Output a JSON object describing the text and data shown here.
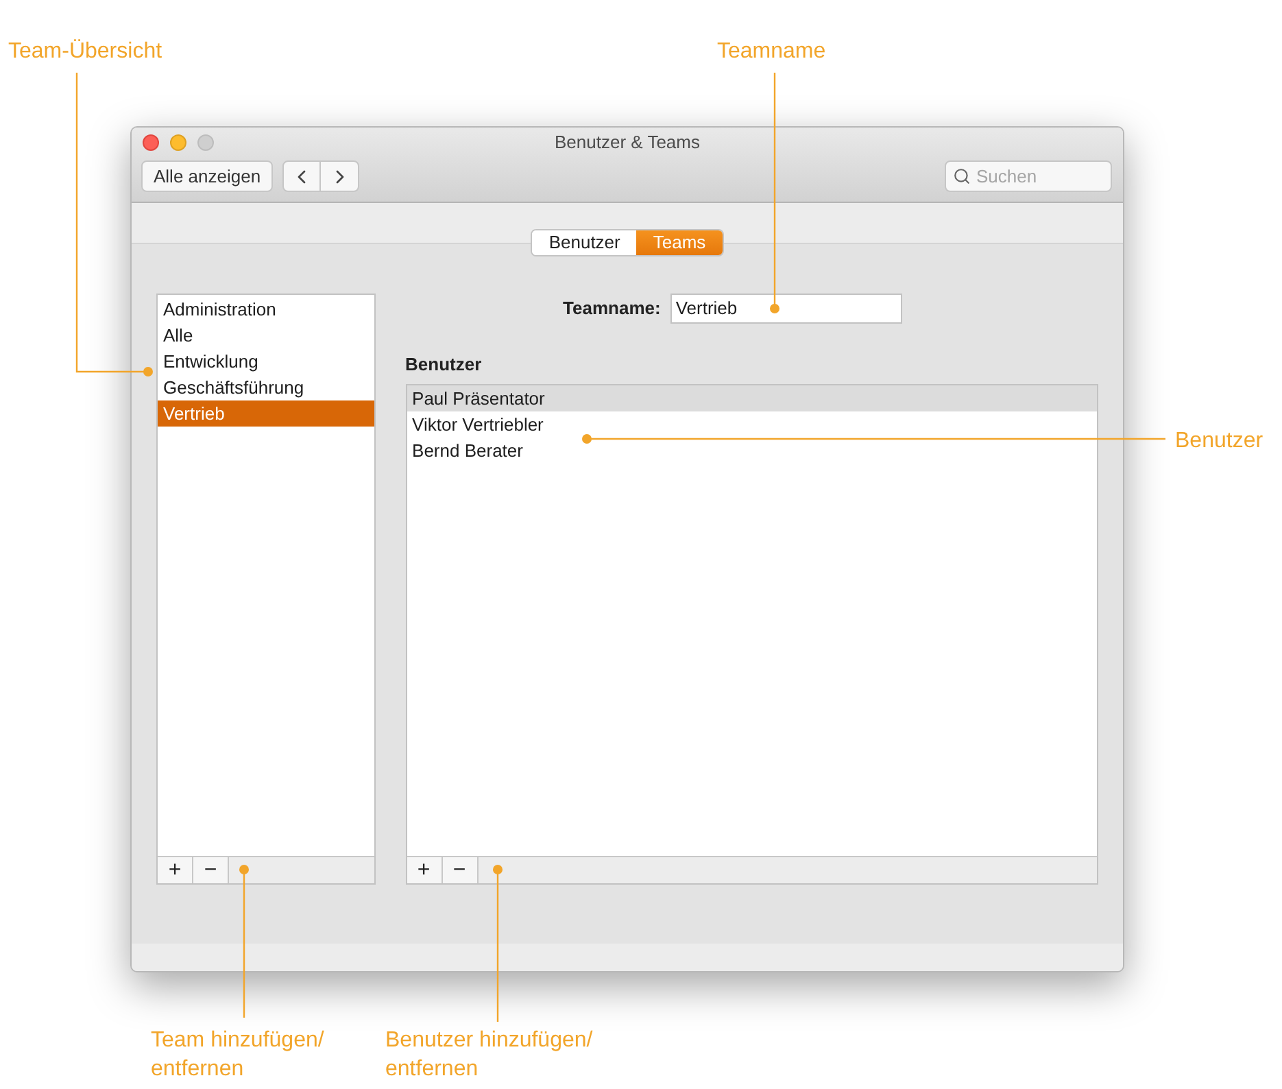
{
  "window": {
    "title": "Benutzer & Teams"
  },
  "toolbar": {
    "show_all": "Alle anzeigen",
    "search_placeholder": "Suchen"
  },
  "tabs": [
    {
      "label": "Benutzer",
      "selected": false
    },
    {
      "label": "Teams",
      "selected": true
    }
  ],
  "teams": {
    "items": [
      {
        "label": "Administration",
        "selected": false
      },
      {
        "label": "Alle",
        "selected": false
      },
      {
        "label": "Entwicklung",
        "selected": false
      },
      {
        "label": "Geschäftsführung",
        "selected": false
      },
      {
        "label": "Vertrieb",
        "selected": true
      }
    ],
    "buttons": [
      "+",
      "−"
    ]
  },
  "teamname": {
    "label": "Teamname:",
    "value": "Vertrieb"
  },
  "members": {
    "heading": "Benutzer",
    "items": [
      {
        "label": "Paul Präsentator",
        "selected": true
      },
      {
        "label": "Viktor Vertriebler",
        "selected": false
      },
      {
        "label": "Bernd Berater",
        "selected": false
      }
    ],
    "buttons": [
      "+",
      "−"
    ]
  },
  "callouts": [
    {
      "label": "Team-Übersicht"
    },
    {
      "label": "Teamname"
    },
    {
      "label": "Benutzer"
    },
    {
      "label": "Team hinzufügen/ entfernen"
    },
    {
      "label": "Benutzer hinzufügen/ entfernen"
    }
  ]
}
